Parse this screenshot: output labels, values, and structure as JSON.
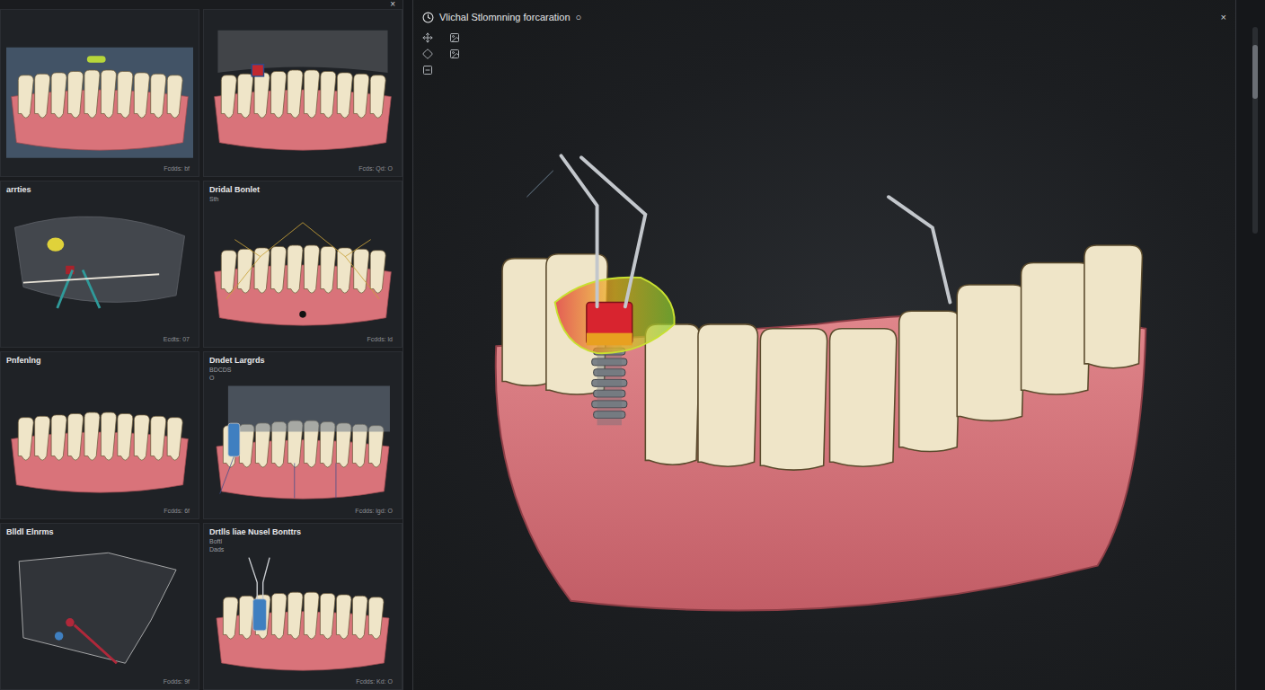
{
  "left_panel": {
    "close": "×",
    "cards": [
      {
        "footer": "Fcdds: bf",
        "kind": "shell",
        "color": "#b7d63a"
      },
      {
        "footer": "Fcds: Qd: O",
        "kind": "upper",
        "color": "#c0282f"
      },
      {
        "title": "arrties",
        "footer": "Ecdts: 07",
        "kind": "scan",
        "color": "#e0d23a"
      },
      {
        "title": "Dridal Bonlet",
        "lines": [
          "Sth"
        ],
        "footer": "Fcdds: ld",
        "kind": "guides",
        "color": "#c9a23a"
      },
      {
        "title": "Pnfenlng",
        "footer": "Fcdds: 6f",
        "kind": "plain",
        "color": "#d9737a"
      },
      {
        "title": "Dndet Largrds",
        "lines": [
          "BDCDS",
          "O"
        ],
        "footer": "Fcdds: lgd: O",
        "kind": "block",
        "color": "#3f7fc0"
      },
      {
        "title": "Blldl Elnrms",
        "footer": "Fodds: 9f",
        "kind": "outline",
        "color": "#b0283a"
      },
      {
        "title": "Drtlls liae Nusel Bonttrs",
        "lines": [
          "Boftl",
          "Dads"
        ],
        "footer": "Fcdds: Kd: O",
        "kind": "probes",
        "color": "#3f7fc0"
      }
    ]
  },
  "main": {
    "title": "Vlichal Stlomnning forcaration",
    "title_mark": "○",
    "close": "×"
  }
}
